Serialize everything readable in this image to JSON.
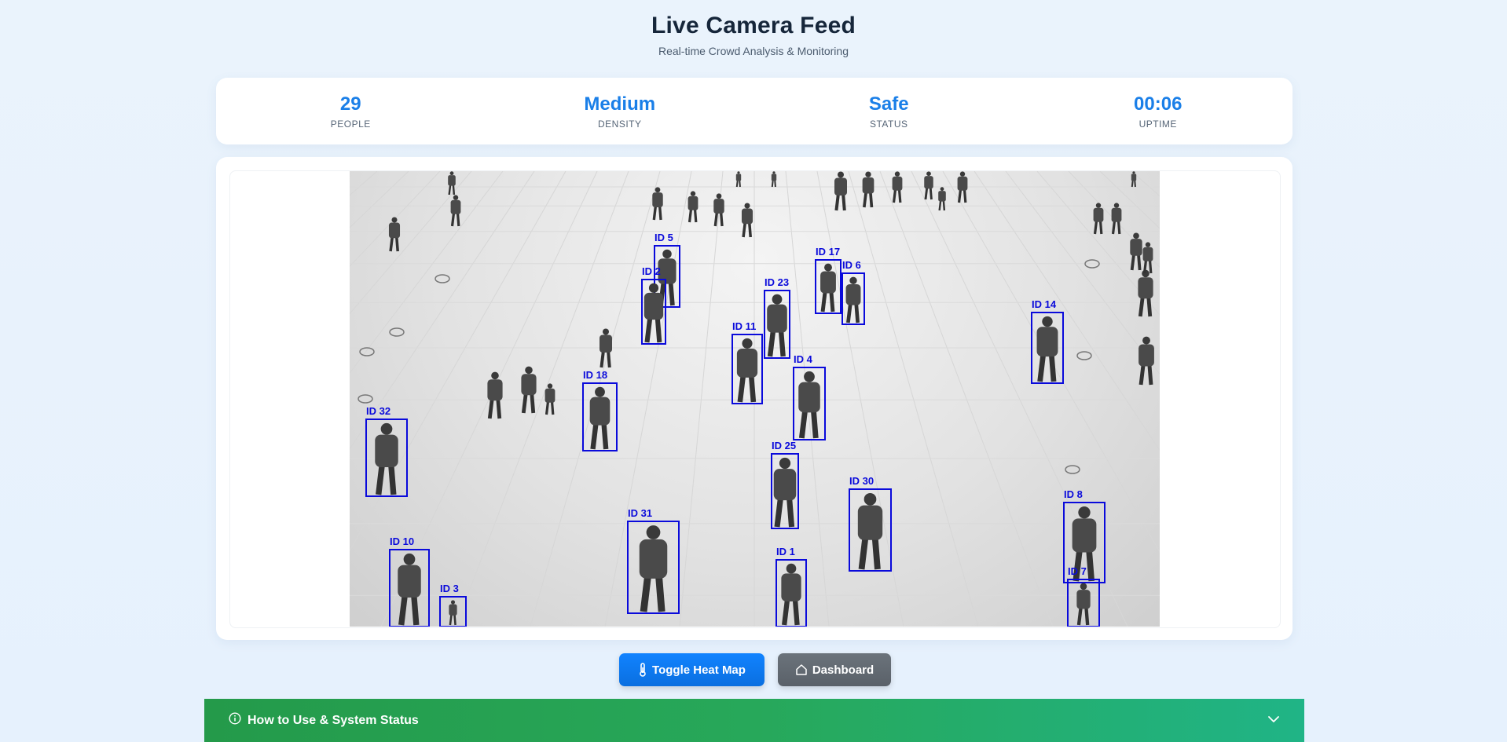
{
  "header": {
    "title": "Live Camera Feed",
    "subtitle": "Real-time Crowd Analysis & Monitoring"
  },
  "stats": [
    {
      "value": "29",
      "label": "PEOPLE"
    },
    {
      "value": "Medium",
      "label": "DENSITY"
    },
    {
      "value": "Safe",
      "label": "STATUS"
    },
    {
      "value": "00:06",
      "label": "UPTIME"
    }
  ],
  "video": {
    "box_color": "#0a0adb",
    "detections": [
      "ID 5",
      "ID 2",
      "ID 17",
      "ID 6",
      "ID 23",
      "ID 14",
      "ID 11",
      "ID 4",
      "ID 18",
      "ID 32",
      "ID 25",
      "ID 30",
      "ID 8",
      "ID 31",
      "ID 10",
      "ID 1",
      "ID 3",
      "ID 7"
    ]
  },
  "buttons": {
    "heatmap_label": "Toggle Heat Map",
    "heatmap_icon": "thermometer-icon",
    "dashboard_label": "Dashboard",
    "dashboard_icon": "home-icon"
  },
  "help": {
    "label": "How to Use & System Status",
    "icon": "info-icon",
    "toggle_icon": "chevron-down-icon"
  },
  "colors": {
    "accent": "#1a7fe8",
    "primary_button": "#0a6fe0",
    "secondary_button": "#5a6169",
    "help_bar": "#27a85a"
  }
}
